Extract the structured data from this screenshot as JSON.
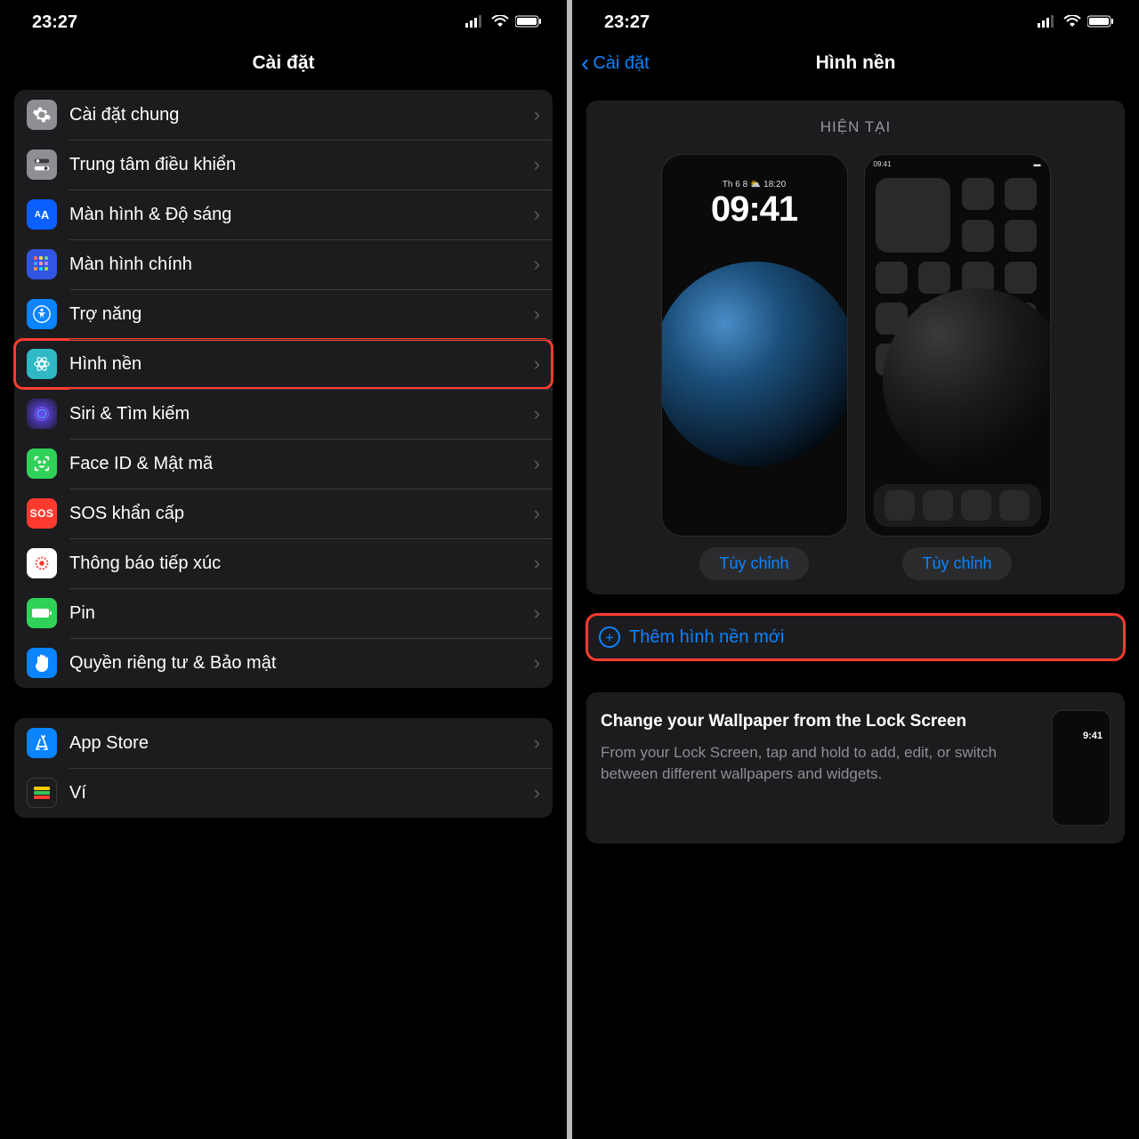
{
  "status": {
    "time": "23:27"
  },
  "left": {
    "title": "Cài đặt",
    "items": [
      {
        "label": "Cài đặt chung",
        "icon": "gear",
        "color": "#8e8e93"
      },
      {
        "label": "Trung tâm điều khiển",
        "icon": "switches",
        "color": "#8e8e93"
      },
      {
        "label": "Màn hình & Độ sáng",
        "icon": "AA",
        "color": "#0a84ff"
      },
      {
        "label": "Màn hình chính",
        "icon": "grid",
        "color": "#3255e2"
      },
      {
        "label": "Trợ năng",
        "icon": "person",
        "color": "#0a84ff"
      },
      {
        "label": "Hình nền",
        "icon": "flower",
        "color": "#2fb8c5"
      },
      {
        "label": "Siri & Tìm kiếm",
        "icon": "siri",
        "color": "#1c1c1eG"
      },
      {
        "label": "Face ID & Mật mã",
        "icon": "face",
        "color": "#30d158"
      },
      {
        "label": "SOS khẩn cấp",
        "icon": "SOS",
        "color": "#ff3b30"
      },
      {
        "label": "Thông báo tiếp xúc",
        "icon": "virus",
        "color": "#ffffff"
      },
      {
        "label": "Pin",
        "icon": "battery",
        "color": "#30d158"
      },
      {
        "label": "Quyền riêng tư & Bảo mật",
        "icon": "hand",
        "color": "#0a84ff"
      }
    ],
    "group2": [
      {
        "label": "App Store",
        "icon": "A",
        "color": "#0a84ff"
      },
      {
        "label": "Ví",
        "icon": "wallet",
        "color": "#1c1c1e"
      }
    ]
  },
  "right": {
    "back": "Cài đặt",
    "title": "Hình nền",
    "current_label": "HIỆN TẠI",
    "lock_date": "Th 6 8 ⛅ 18:20",
    "lock_time": "09:41",
    "home_time": "09:41",
    "customize": "Tùy chỉnh",
    "add_new": "Thêm hình nền mới",
    "tip_title": "Change your Wallpaper from the Lock Screen",
    "tip_desc": "From your Lock Screen, tap and hold to add, edit, or switch between different wallpapers and widgets.",
    "tip_time": "9:41"
  }
}
